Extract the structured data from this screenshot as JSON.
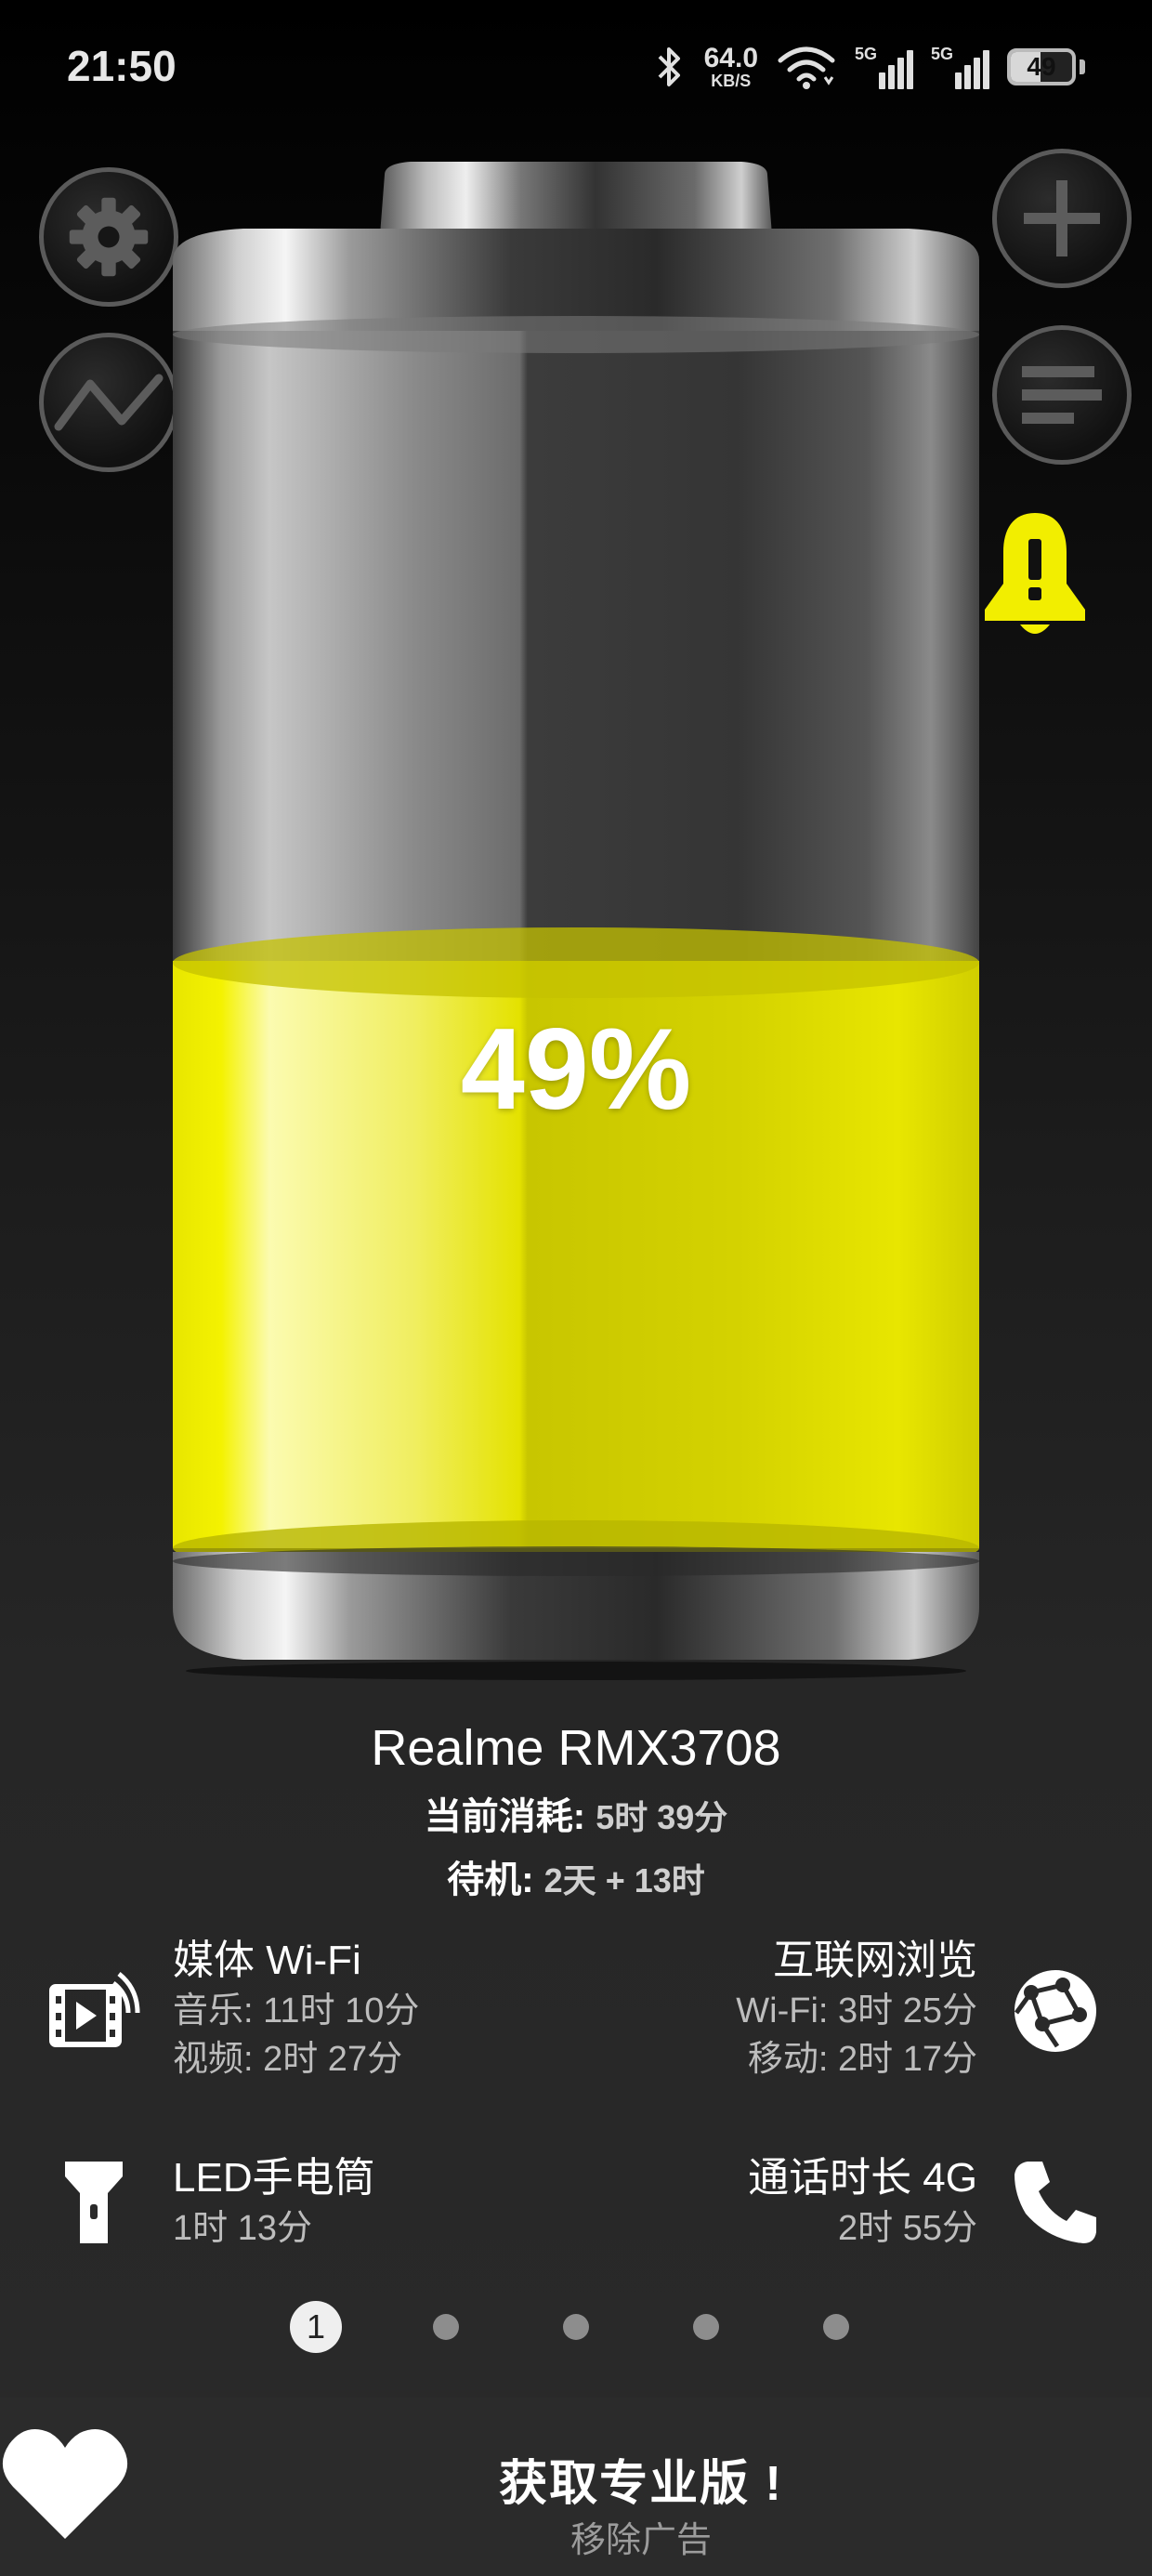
{
  "status_bar": {
    "time": "21:50",
    "net_speed_value": "64.0",
    "net_speed_unit": "KB/S",
    "sim1_tag": "5G",
    "sim2_tag": "5G",
    "battery_level": "49",
    "icons": [
      "bluetooth-icon",
      "wifi-icon",
      "signal-icon",
      "battery-icon"
    ]
  },
  "toolbar": {
    "left": [
      "gear-icon",
      "graph-icon"
    ],
    "right": [
      "plus-icon",
      "list-icon"
    ],
    "alert": "bell-alert-icon"
  },
  "battery": {
    "percent_text": "49%",
    "level": 0.49,
    "fill_color": "#f2ee00"
  },
  "device": {
    "name": "Realme RMX3708",
    "current_label": "当前消耗:",
    "current_value": "5时 39分",
    "standby_label": "待机:",
    "standby_value": "2天 + 13时"
  },
  "usage": {
    "media": {
      "title": "媒体 Wi-Fi",
      "line1": "音乐: 11时 10分",
      "line2": "视频: 2时 27分"
    },
    "browse": {
      "title": "互联网浏览",
      "line1": "Wi-Fi: 3时 25分",
      "line2": "移动: 2时 17分"
    },
    "led": {
      "title": "LED手电筒",
      "line1": "1时 13分"
    },
    "call": {
      "title": "通话时长 4G",
      "line1": "2时 55分"
    }
  },
  "pager": {
    "current": "1",
    "total": 5
  },
  "footer": {
    "title": "获取专业版 !",
    "subtitle": "移除广告"
  }
}
